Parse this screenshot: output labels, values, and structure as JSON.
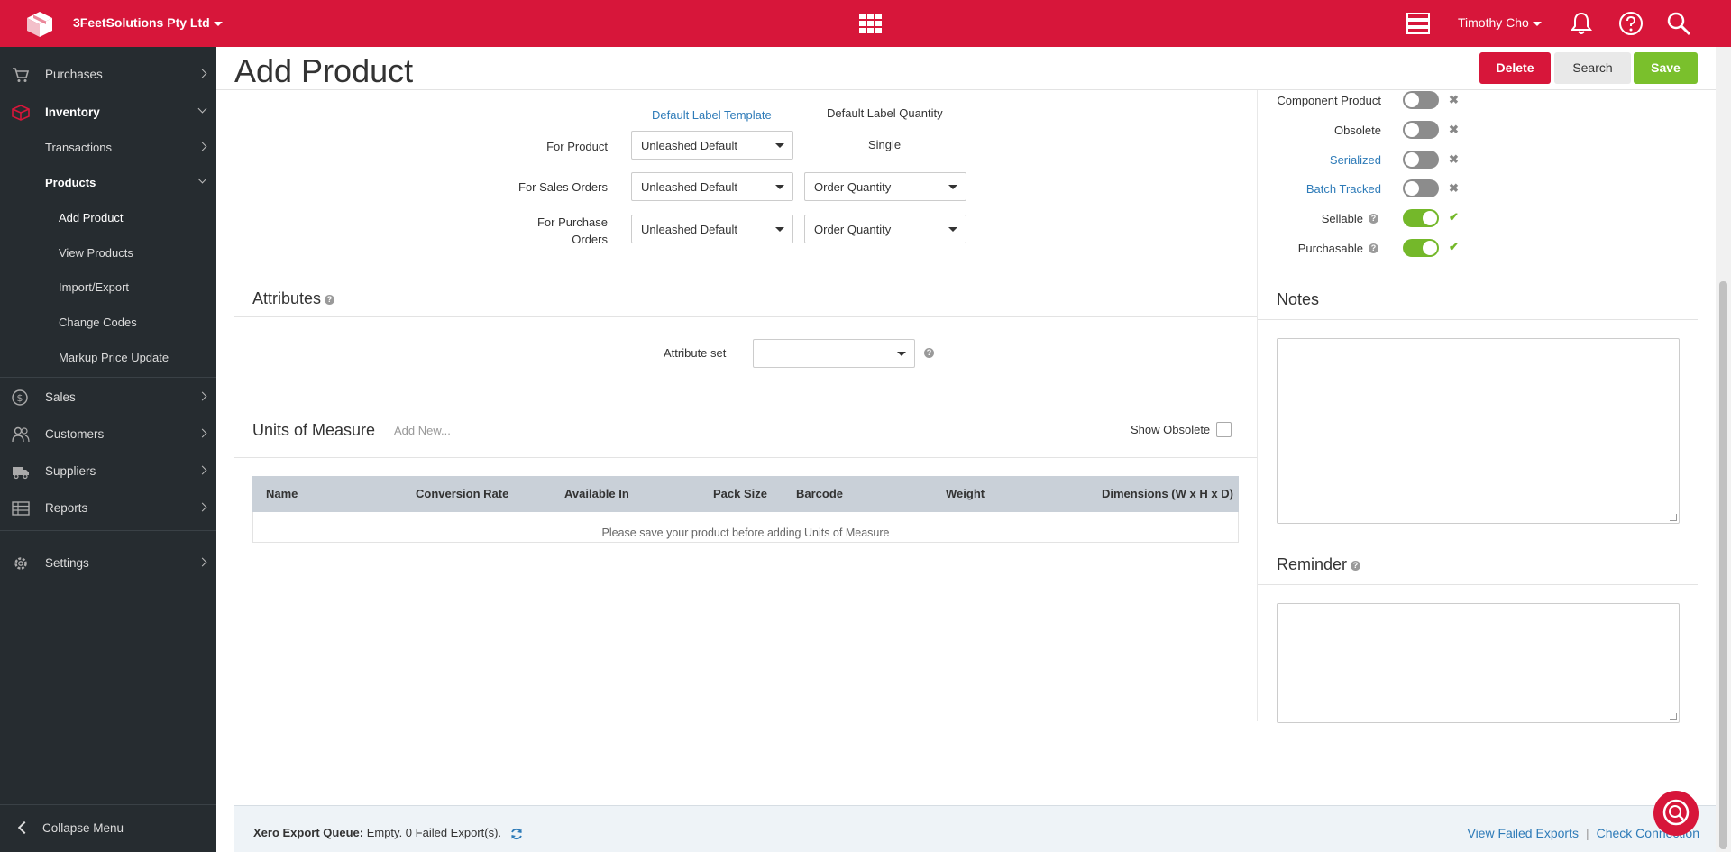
{
  "topbar": {
    "company": "3FeetSolutions Pty Ltd",
    "user": "Timothy Cho",
    "colors": {
      "brand": "#d7163a"
    },
    "icons": [
      "cube-logo-icon",
      "apps-grid-icon",
      "stack-icon",
      "bell-icon",
      "help-icon",
      "search-icon"
    ]
  },
  "sidebar": {
    "items": [
      {
        "label": "Purchases",
        "icon": "cart-icon"
      },
      {
        "label": "Inventory",
        "icon": "box-icon"
      },
      {
        "label": "Sales",
        "icon": "dollar-icon"
      },
      {
        "label": "Customers",
        "icon": "people-icon"
      },
      {
        "label": "Suppliers",
        "icon": "truck-icon"
      },
      {
        "label": "Reports",
        "icon": "table-icon"
      },
      {
        "label": "Settings",
        "icon": "gear-icon"
      }
    ],
    "inventory_sub": {
      "transactions": "Transactions",
      "products": "Products",
      "products_sub": [
        "Add Product",
        "View Products",
        "Import/Export",
        "Change Codes",
        "Markup Price Update"
      ]
    },
    "collapse": "Collapse Menu"
  },
  "page": {
    "title": "Add Product",
    "buttons": {
      "delete": "Delete",
      "search": "Search",
      "save": "Save"
    }
  },
  "labels_section": {
    "col_template": "Default Label Template",
    "col_quantity": "Default Label Quantity",
    "rows": [
      {
        "label": "For Product",
        "template": "Unleashed Default",
        "quantity": "Single"
      },
      {
        "label": "For Sales Orders",
        "template": "Unleashed Default",
        "quantity": "Order Quantity"
      },
      {
        "label_line1": "For Purchase",
        "label_line2": "Orders",
        "template": "Unleashed Default",
        "quantity": "Order Quantity"
      }
    ]
  },
  "attributes": {
    "title": "Attributes",
    "attribute_set_label": "Attribute set",
    "attribute_set_value": ""
  },
  "uom": {
    "title": "Units of Measure",
    "add_new": "Add New...",
    "show_obsolete": "Show Obsolete",
    "columns": [
      "Name",
      "Conversion Rate",
      "Available In",
      "Pack Size",
      "Barcode",
      "Weight",
      "Dimensions (W x H x D)"
    ],
    "empty": "Please save your product before adding Units of Measure"
  },
  "flags": [
    {
      "label": "Component Product",
      "on": false,
      "link": false
    },
    {
      "label": "Obsolete",
      "on": false,
      "link": false
    },
    {
      "label": "Serialized",
      "on": false,
      "link": true
    },
    {
      "label": "Batch Tracked",
      "on": false,
      "link": true
    },
    {
      "label": "Sellable",
      "on": true,
      "link": false,
      "help": true
    },
    {
      "label": "Purchasable",
      "on": true,
      "link": false,
      "help": true
    }
  ],
  "notes": {
    "title": "Notes",
    "value": ""
  },
  "reminder": {
    "title": "Reminder",
    "value": ""
  },
  "footer": {
    "queue_label": "Xero Export Queue:",
    "queue_status": "Empty. 0 Failed Export(s).",
    "link_failed": "View Failed Exports",
    "link_check": "Check Connection"
  }
}
